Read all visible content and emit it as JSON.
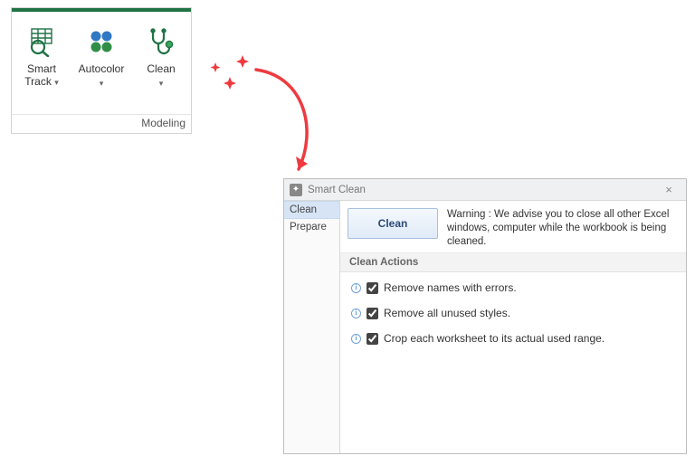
{
  "ribbon": {
    "group_label": "Modeling",
    "items": [
      {
        "label_line1": "Smart",
        "label_line2": "Track",
        "icon": "smart-track"
      },
      {
        "label_line1": "Autocolor",
        "label_line2": "",
        "icon": "autocolor"
      },
      {
        "label_line1": "Clean",
        "label_line2": "",
        "icon": "clean"
      }
    ]
  },
  "dialog": {
    "title": "Smart Clean",
    "close_glyph": "×",
    "tabs": [
      {
        "label": "Clean",
        "active": true
      },
      {
        "label": "Prepare",
        "active": false
      }
    ],
    "clean_button": "Clean",
    "warning": "Warning : We advise you to close all other Excel windows, computer while the workbook is being cleaned.",
    "actions_header": "Clean Actions",
    "actions": [
      {
        "label": "Remove names with errors.",
        "checked": true
      },
      {
        "label": "Remove all unused styles.",
        "checked": true
      },
      {
        "label": "Crop each worksheet to its actual used range.",
        "checked": true
      }
    ]
  },
  "colors": {
    "excel_green": "#217346",
    "accent_blue": "#2b4a75",
    "arrow_red": "#ee3a3f"
  }
}
